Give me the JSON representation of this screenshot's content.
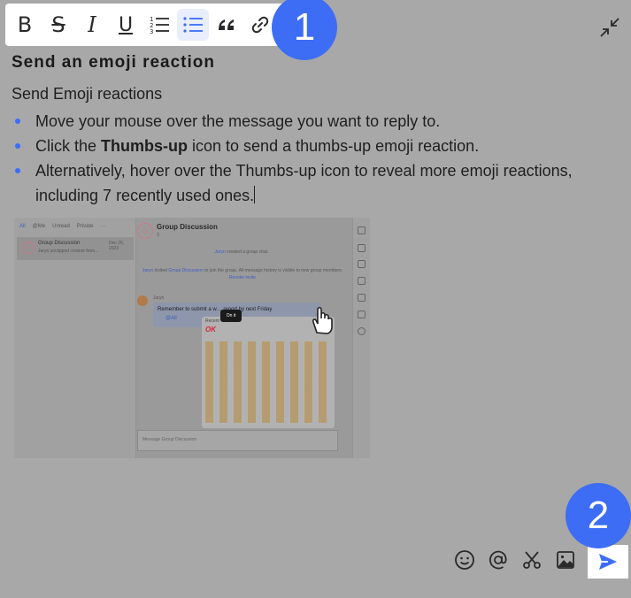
{
  "toolbar": {
    "buttons": [
      {
        "name": "bold",
        "icon": "bold-icon",
        "glyph": "B"
      },
      {
        "name": "strikethrough",
        "icon": "strikethrough-icon",
        "glyph": "S"
      },
      {
        "name": "italic",
        "icon": "italic-icon",
        "glyph": "I"
      },
      {
        "name": "underline",
        "icon": "underline-icon",
        "glyph": "U"
      },
      {
        "name": "ordered-list",
        "icon": "ordered-list-icon"
      },
      {
        "name": "bullet-list",
        "icon": "bullet-list-icon",
        "active": true
      },
      {
        "name": "quote",
        "icon": "quote-icon"
      },
      {
        "name": "link",
        "icon": "link-icon"
      }
    ]
  },
  "badges": {
    "one": "1",
    "two": "2"
  },
  "colors": {
    "accent": "#3d6df5",
    "overlay": "#a8a8a8",
    "text": "#1f1f1f"
  },
  "content": {
    "heading": "Send an emoji reaction",
    "intro": "Send Emoji reactions",
    "bullets": {
      "b1": "Move your mouse over the message you want to reply to.",
      "b2_pre": "Click the ",
      "b2_bold": "Thumbs-up",
      "b2_post": " icon to send a thumbs-up emoji reaction.",
      "b3": "Alternatively, hover over the Thumbs-up icon to reveal more emoji reactions, including 7 recently used ones."
    }
  },
  "screenshot": {
    "tabs": [
      "All",
      "@Me",
      "Unread",
      "Private",
      "···"
    ],
    "conversation": {
      "avatar": "G",
      "name": "Group Discussion",
      "date": "Dec 26, 2023",
      "snippet": "Jaryn unclipped content from..."
    },
    "chat": {
      "avatar": "G",
      "title": "Group Discussion",
      "member_count": "3",
      "sys1_user": "Jaryn",
      "sys1_text": " created a group chat.",
      "sys2_user": "Jaryn",
      "sys2_mid": " invited ",
      "sys2_group": "Group Discussion",
      "sys2_text": " to join the group. All message history is visible to new group members. ",
      "sys2_link": "Revoke invite",
      "sender": "Jaryn",
      "message": "Remember to submit a w… report by next Friday",
      "mention": "@All",
      "tooltip": "On it",
      "composer_placeholder": "Message Group Discussion",
      "picker_top": "OK",
      "picker_label": "Recent"
    }
  },
  "bottom_bar": {
    "icons": [
      "emoji-icon",
      "mention-icon",
      "scissors-icon",
      "image-icon"
    ],
    "send": "send-icon"
  }
}
